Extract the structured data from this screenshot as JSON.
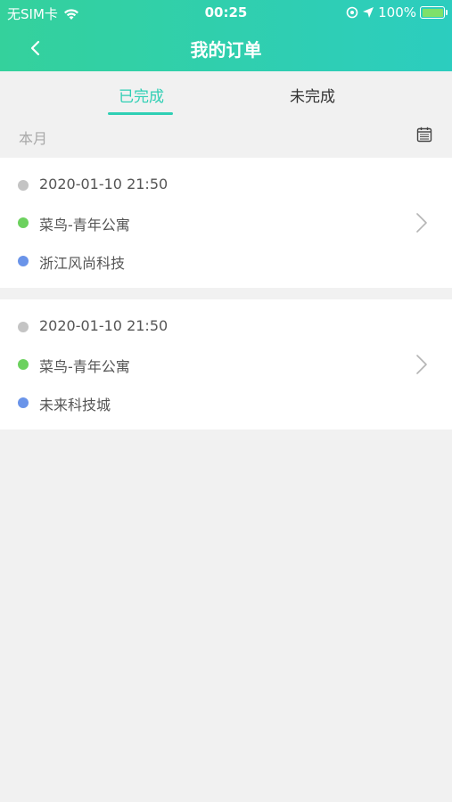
{
  "status_bar": {
    "carrier": "无SIM卡",
    "time": "00:25",
    "battery": "100%"
  },
  "navbar": {
    "title": "我的订单"
  },
  "tabs": [
    {
      "label": "已完成",
      "active": true
    },
    {
      "label": "未完成",
      "active": false
    }
  ],
  "filter": {
    "month_label": "本月"
  },
  "orders": [
    {
      "time": "2020-01-10 21:50",
      "from": "菜鸟-青年公寓",
      "to": "浙江风尚科技"
    },
    {
      "time": "2020-01-10 21:50",
      "from": "菜鸟-青年公寓",
      "to": "未来科技城"
    }
  ],
  "colors": {
    "accent": "#2fcfb4",
    "header_start": "#34d19c",
    "header_end": "#2ccdbf",
    "dot_time": "#c4c4c4",
    "dot_from": "#6cd15e",
    "dot_to": "#6a94e9"
  }
}
